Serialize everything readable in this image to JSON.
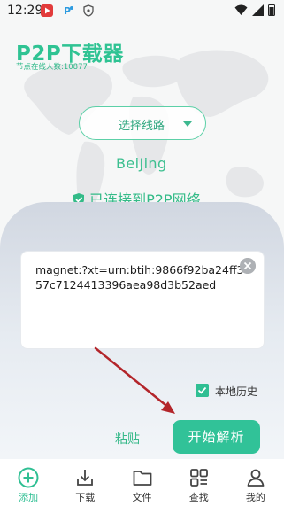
{
  "status_bar": {
    "time": "12:29",
    "icons": [
      "video-app-icon",
      "p-app-icon",
      "shield-icon"
    ],
    "right_icons": [
      "wifi-icon",
      "signal-icon",
      "battery-icon"
    ]
  },
  "header": {
    "app_title": "P2P下载器",
    "online_nodes": "节点在线人数:10877"
  },
  "route": {
    "select_label": "选择线路",
    "city": "BeiJing",
    "connection_status": "已连接到P2P网络"
  },
  "input": {
    "magnet_value": "magnet:?xt=urn:btih:9866f92ba24ff357c7124413396aea98d3b52aed"
  },
  "options": {
    "local_history_label": "本地历史",
    "local_history_checked": true
  },
  "actions": {
    "paste_label": "粘贴",
    "parse_label": "开始解析"
  },
  "bottom_nav": {
    "items": [
      {
        "label": "添加",
        "icon": "add-circle-icon",
        "active": true
      },
      {
        "label": "下载",
        "icon": "download-icon",
        "active": false
      },
      {
        "label": "文件",
        "icon": "folder-icon",
        "active": false
      },
      {
        "label": "查找",
        "icon": "grid-search-icon",
        "active": false
      },
      {
        "label": "我的",
        "icon": "profile-icon",
        "active": false
      }
    ]
  },
  "colors": {
    "accent": "#31c298",
    "arrow": "#b3252a"
  }
}
